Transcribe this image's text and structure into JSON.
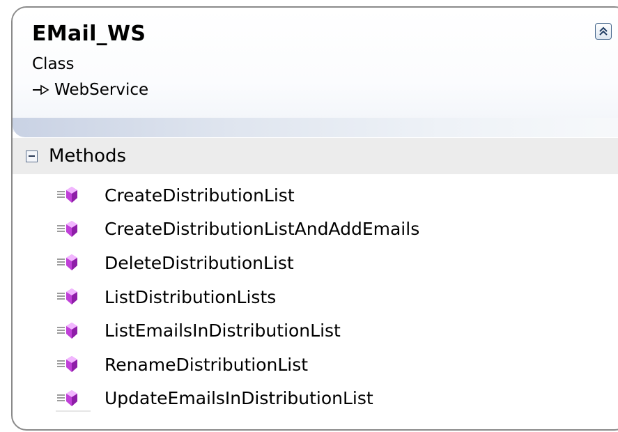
{
  "class_shape": {
    "name": "EMail_WS",
    "kind": "Class",
    "base_class": "WebService",
    "collapse_icon": "double-chevron-up-icon"
  },
  "methods_section": {
    "label": "Methods",
    "toggle_icon": "minus-box-icon",
    "items": [
      {
        "name": "CreateDistributionList",
        "icon": "public-method-icon"
      },
      {
        "name": "CreateDistributionListAndAddEmails",
        "icon": "public-method-icon"
      },
      {
        "name": "DeleteDistributionList",
        "icon": "public-method-icon"
      },
      {
        "name": "ListDistributionLists",
        "icon": "public-method-icon"
      },
      {
        "name": "ListEmailsInDistributionList",
        "icon": "public-method-icon"
      },
      {
        "name": "RenameDistributionList",
        "icon": "public-method-icon"
      },
      {
        "name": "UpdateEmailsInDistributionList",
        "icon": "public-method-icon"
      }
    ]
  },
  "colors": {
    "method_icon": "#c040d8",
    "header_band": "#c9d2e4",
    "section_bg": "#ececec",
    "border": "#8a8a8a"
  }
}
